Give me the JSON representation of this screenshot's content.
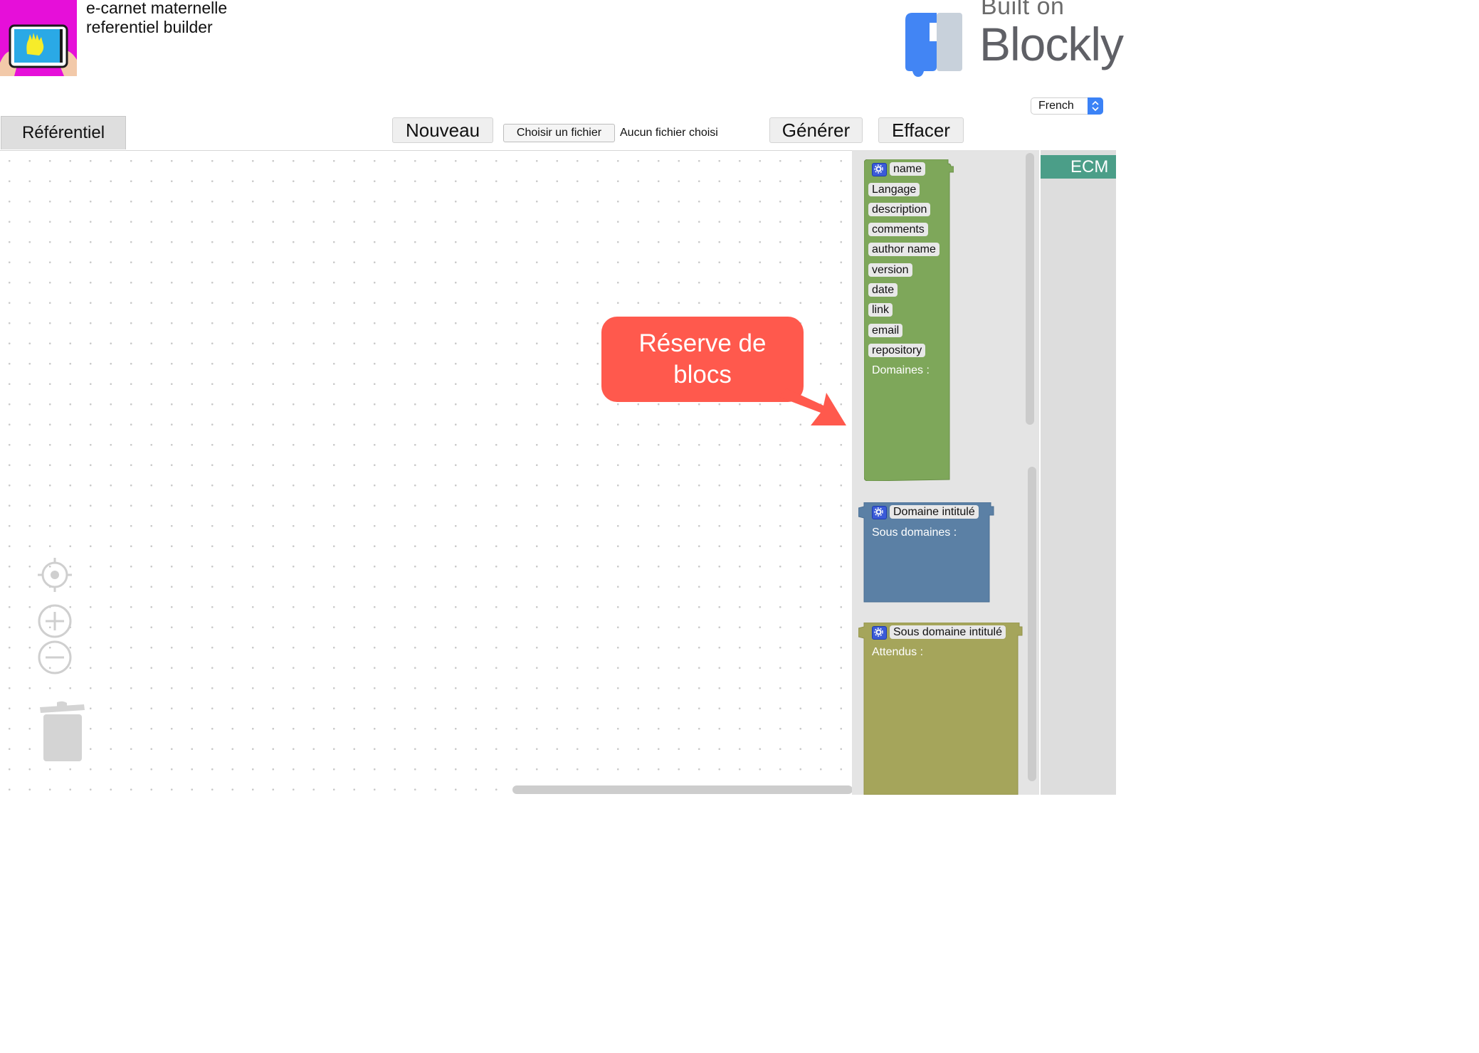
{
  "header": {
    "app_title": "e-carnet maternelle\nreferentiel builder",
    "brand_built_on": "Built on",
    "brand_name": "Blockly",
    "language_select": {
      "value": "French",
      "icon": "select-arrows-icon"
    }
  },
  "toolbar": {
    "tab_label": "Référentiel",
    "new_label": "Nouveau",
    "file_button_label": "Choisir un fichier",
    "file_status": "Aucun fichier choisi",
    "generate_label": "Générer",
    "clear_label": "Effacer"
  },
  "workspace": {
    "controls": [
      "recenter-icon",
      "zoom-in-icon",
      "zoom-out-icon",
      "trash-icon"
    ]
  },
  "flyout": {
    "blocks": [
      {
        "color": "#7ea75a",
        "fields": [
          "name",
          "Langage",
          "description",
          "comments",
          "author name",
          "version",
          "date",
          "link",
          "email",
          "repository"
        ],
        "label": "Domaines :"
      },
      {
        "color": "#5b80a5",
        "title": "Domaine intitulé",
        "label": "Sous domaines :"
      },
      {
        "color": "#a5a55b",
        "title": "Sous domaine intitulé",
        "label": "Attendus :"
      }
    ]
  },
  "categories": [
    {
      "label": "ECM",
      "color": "#4b9e88"
    }
  ],
  "callout": {
    "text": "Réserve de\nblocs",
    "color": "#ff594d"
  }
}
